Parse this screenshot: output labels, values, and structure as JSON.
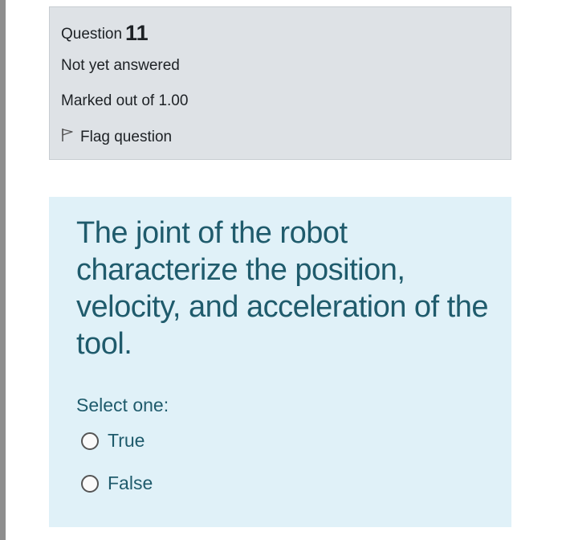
{
  "question": {
    "label": "Question",
    "number": "11",
    "state": "Not yet answered",
    "grade": "Marked out of 1.00",
    "flag_label": "Flag question",
    "flag_icon": "flag-outline-icon"
  },
  "content": {
    "text": "The joint of the robot characterize the position, velocity, and acceleration of the tool.",
    "prompt": "Select one:",
    "options": [
      {
        "label": "True",
        "selected": false
      },
      {
        "label": "False",
        "selected": false
      }
    ]
  },
  "colors": {
    "info_bg": "#dee2e6",
    "content_bg": "#e0f1f8",
    "content_text": "#1f5b6c"
  }
}
